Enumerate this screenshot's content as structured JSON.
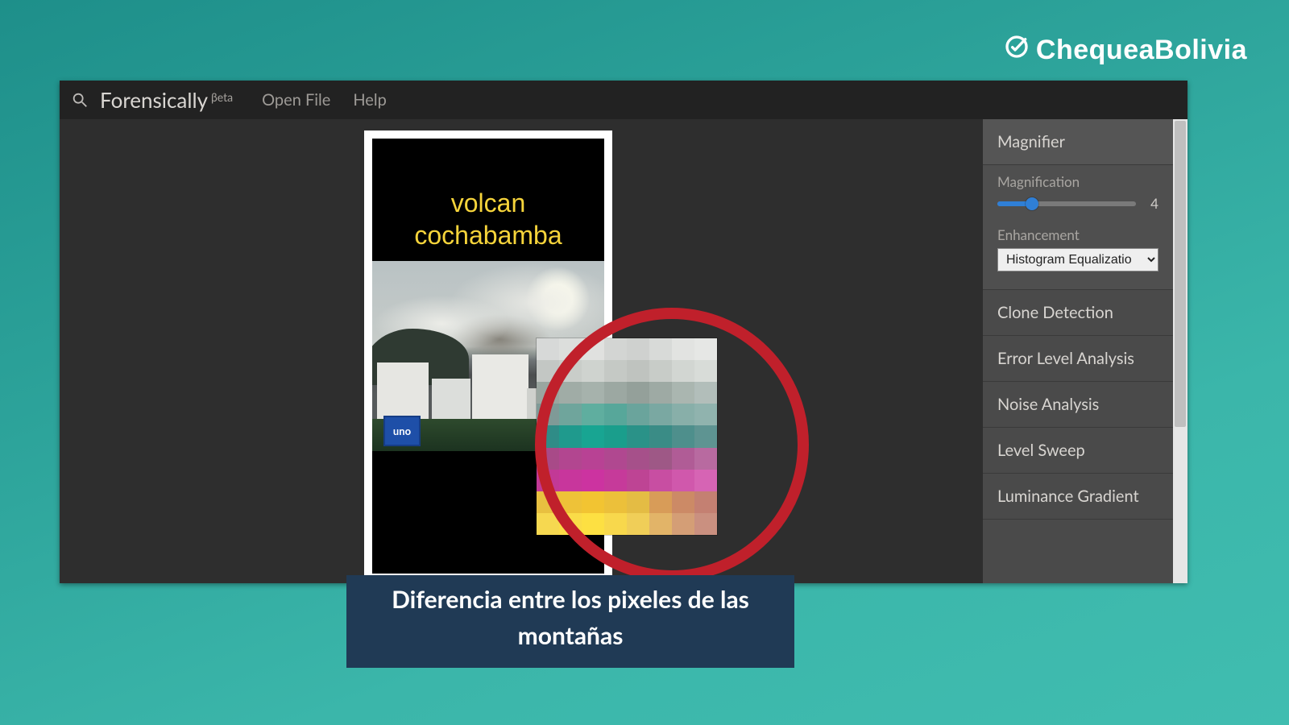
{
  "watermark": {
    "text": "ChequeaBolivia"
  },
  "menubar": {
    "brand": "Forensically",
    "brand_sup": "βeta",
    "items": [
      "Open File",
      "Help"
    ]
  },
  "image_overlay": {
    "line1": "volcan",
    "line2": "cochabamba",
    "sign": "uno"
  },
  "sidebar": {
    "panels": [
      {
        "title": "Magnifier",
        "active": true
      },
      {
        "title": "Clone Detection",
        "active": false
      },
      {
        "title": "Error Level Analysis",
        "active": false
      },
      {
        "title": "Noise Analysis",
        "active": false
      },
      {
        "title": "Level Sweep",
        "active": false
      },
      {
        "title": "Luminance Gradient",
        "active": false
      }
    ],
    "magnifier": {
      "magnification_label": "Magnification",
      "magnification_value": "4",
      "enhancement_label": "Enhancement",
      "enhancement_selected": "Histogram Equalizatio"
    }
  },
  "caption": {
    "line1": "Diferencia entre los pixeles de las",
    "line2": "montañas"
  },
  "colors": {
    "accent_red": "#c0202b",
    "caption_bg": "#203a55",
    "slider_blue": "#2f7fd6"
  }
}
